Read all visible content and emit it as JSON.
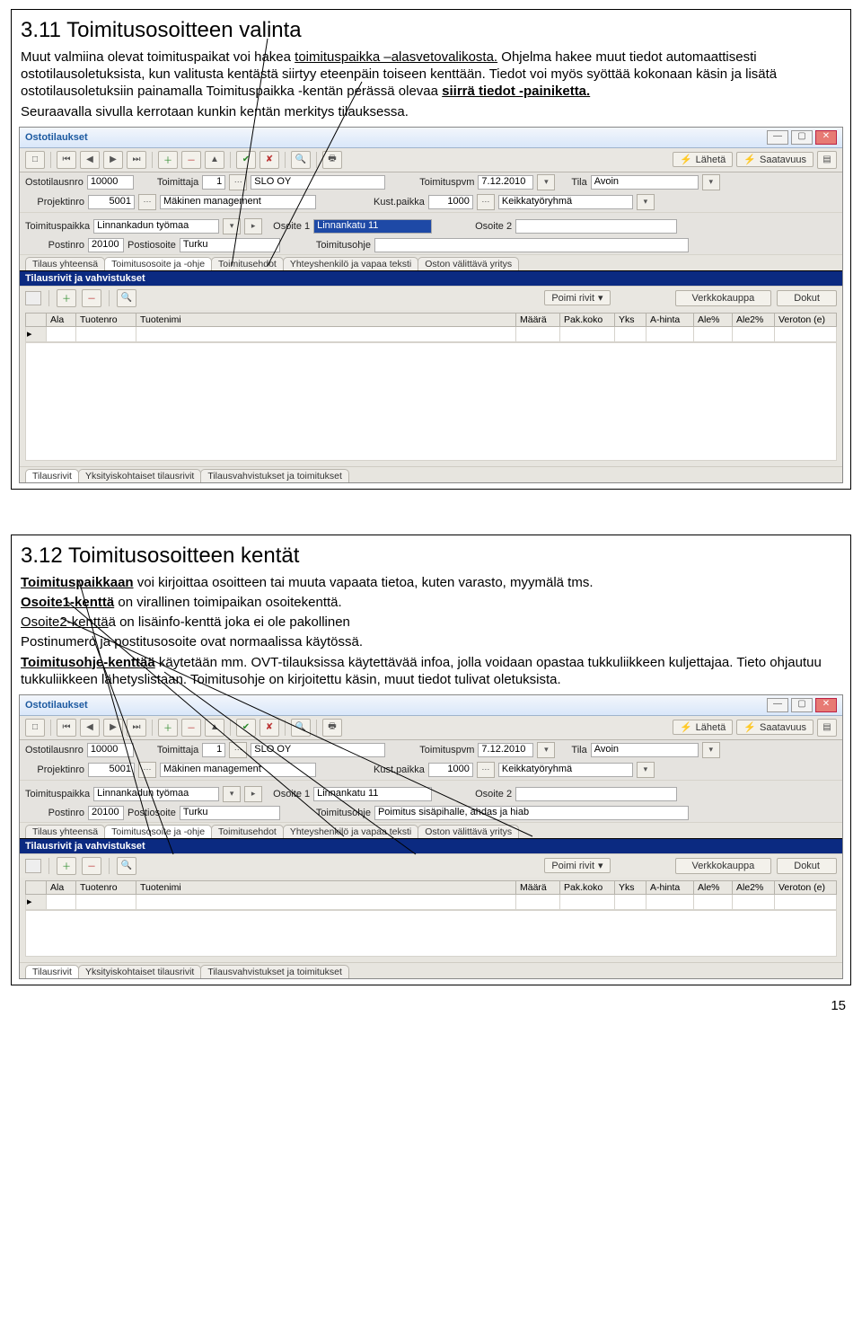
{
  "section1": {
    "title": "3.11 Toimitusosoitteen valinta",
    "p1a": "Muut valmiina olevat toimituspaikat voi hakea ",
    "p1b": "toimituspaikka –alasvetovalikosta.",
    "p1c": " Ohjelma hakee muut tiedot automaattisesti ostotilausoletuksista, kun valitusta kentästä siirtyy eteenpäin toiseen kenttään. Tiedot voi myös syöttää kokonaan käsin ja lisätä ostotilausoletuksiin painamalla Toimituspaikka -kentän perässä olevaa ",
    "p1d": "siirrä tiedot -painiketta.",
    "p2": "Seuraavalla sivulla kerrotaan kunkin kentän merkitys tilauksessa."
  },
  "section2": {
    "title": "3.12 Toimitusosoitteen kentät",
    "l1a": "Toimituspaikkaan",
    "l1b": " voi kirjoittaa osoitteen tai muuta vapaata tietoa, kuten varasto, myymälä tms.",
    "l2a": "Osoite1-kenttä",
    "l2b": " on virallinen toimipaikan osoitekenttä.",
    "l3a": "Osoite2-kenttä",
    "l3b": "ä on lisäinfo-kenttä joka ei ole pakollinen",
    "l4": "Postinumero ja postitusosoite ovat normaalissa käytössä.",
    "l5a": "Toimitusohje-kenttää",
    "l5b": " käytetään mm. OVT-tilauksissa käytettävää infoa, jolla voidaan opastaa tukkuliikkeen kuljettajaa.  Tieto ohjautuu tukkuliikkeen lähetyslistaan. Toimitusohje on kirjoitettu käsin, muut tiedot tulivat oletuksista."
  },
  "app": {
    "title": "Ostotilaukset",
    "laheta": "Lähetä",
    "saatavuus": "Saatavuus",
    "labels": {
      "ostotilausnro": "Ostotilausnro",
      "toimittaja": "Toimittaja",
      "toimituspvm": "Toimituspvm",
      "tila": "Tila",
      "projektinro": "Projektinro",
      "kustpaikka": "Kust.paikka",
      "toimituspaikka": "Toimituspaikka",
      "osoite1": "Osoite 1",
      "osoite2": "Osoite 2",
      "postinro": "Postinro",
      "postiosoite": "Postiosoite",
      "toimitusohje": "Toimitusohje"
    },
    "values": {
      "ostotilausnro": "10000",
      "toimittaja_no": "1",
      "toimittaja_name": "SLO OY",
      "toimituspvm": "7.12.2010",
      "tila": "Avoin",
      "projektinro": "5001",
      "projekti_name": "Mäkinen management",
      "kustpaikka": "1000",
      "kust_name": "Keikkatyöryhmä",
      "toimituspaikka": "Linnankadun työmaa",
      "osoite1": "Linnankatu 11",
      "osoite2": "",
      "postinro": "20100",
      "postiosoite": "Turku",
      "toimitusohje1": "",
      "toimitusohje2": "Poimitus sisäpihalle, ahdas ja hiab"
    },
    "tabs": [
      "Tilaus yhteensä",
      "Toimitusosoite ja -ohje",
      "Toimitusehdot",
      "Yhteyshenkilö ja vapaa teksti",
      "Oston välittävä yritys"
    ],
    "bluebar": "Tilausrivit ja vahvistukset",
    "poimi": "Poimi rivit",
    "verkko": "Verkkokauppa",
    "dokut": "Dokut",
    "gridcols": [
      "Ala",
      "Tuotenro",
      "Tuotenimi",
      "Määrä",
      "Pak.koko",
      "Yks",
      "A-hinta",
      "Ale%",
      "Ale2%",
      "Veroton (e)"
    ],
    "lowtabs": [
      "Tilausrivit",
      "Yksityiskohtaiset tilausrivit",
      "Tilausvahvistukset ja toimitukset"
    ]
  },
  "pagenum": "15"
}
